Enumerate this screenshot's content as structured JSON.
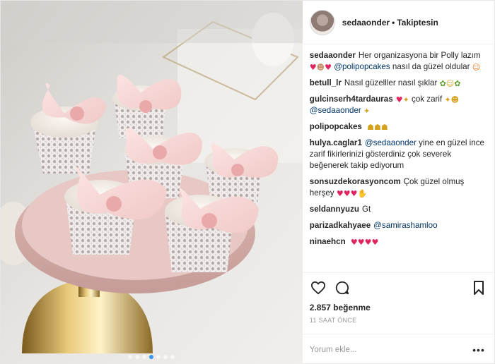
{
  "header": {
    "username": "sedaaonder",
    "separator": "•",
    "follow_status": "Takiptesin"
  },
  "caption": {
    "username": "sedaaonder",
    "text": "Her organizasyona bir Polly lazım",
    "mention": "@polipopcakes",
    "text_after": "nasıl da güzel oldular"
  },
  "comments": [
    {
      "user": "betull_lr",
      "text": "Nasıl güzelller nasıl şıklar"
    },
    {
      "user": "gulcinserh4tardauras",
      "text": "çok zarif",
      "mention": "@sedaaonder"
    },
    {
      "user": "polipopcakes",
      "text": ""
    },
    {
      "user": "hulya.caglar1",
      "mention": "@sedaaonder",
      "text": "yine en güzel ince zarif fikirlerinizi gösterdiniz çok severek beğenerek takip ediyorum"
    },
    {
      "user": "sonsuzdekorasyoncom",
      "text": "Çok güzel olmuş herşey"
    },
    {
      "user": "seldannyuzu",
      "text": "Gt"
    },
    {
      "user": "parizadkahyaee",
      "mention": "@samirashamloo"
    },
    {
      "user": "ninaehcn",
      "text": ""
    }
  ],
  "icons": {
    "like": "heart-outline-icon",
    "comment": "speech-bubble-icon",
    "save": "bookmark-icon",
    "more": "ellipsis-icon"
  },
  "likes_text": "2.857 beğenme",
  "time_text": "11 SAAT ÖNCE",
  "add_comment_placeholder": "Yorum ekle...",
  "carousel": {
    "count": 7,
    "active_index": 3,
    "active_color": "#3897f0"
  }
}
